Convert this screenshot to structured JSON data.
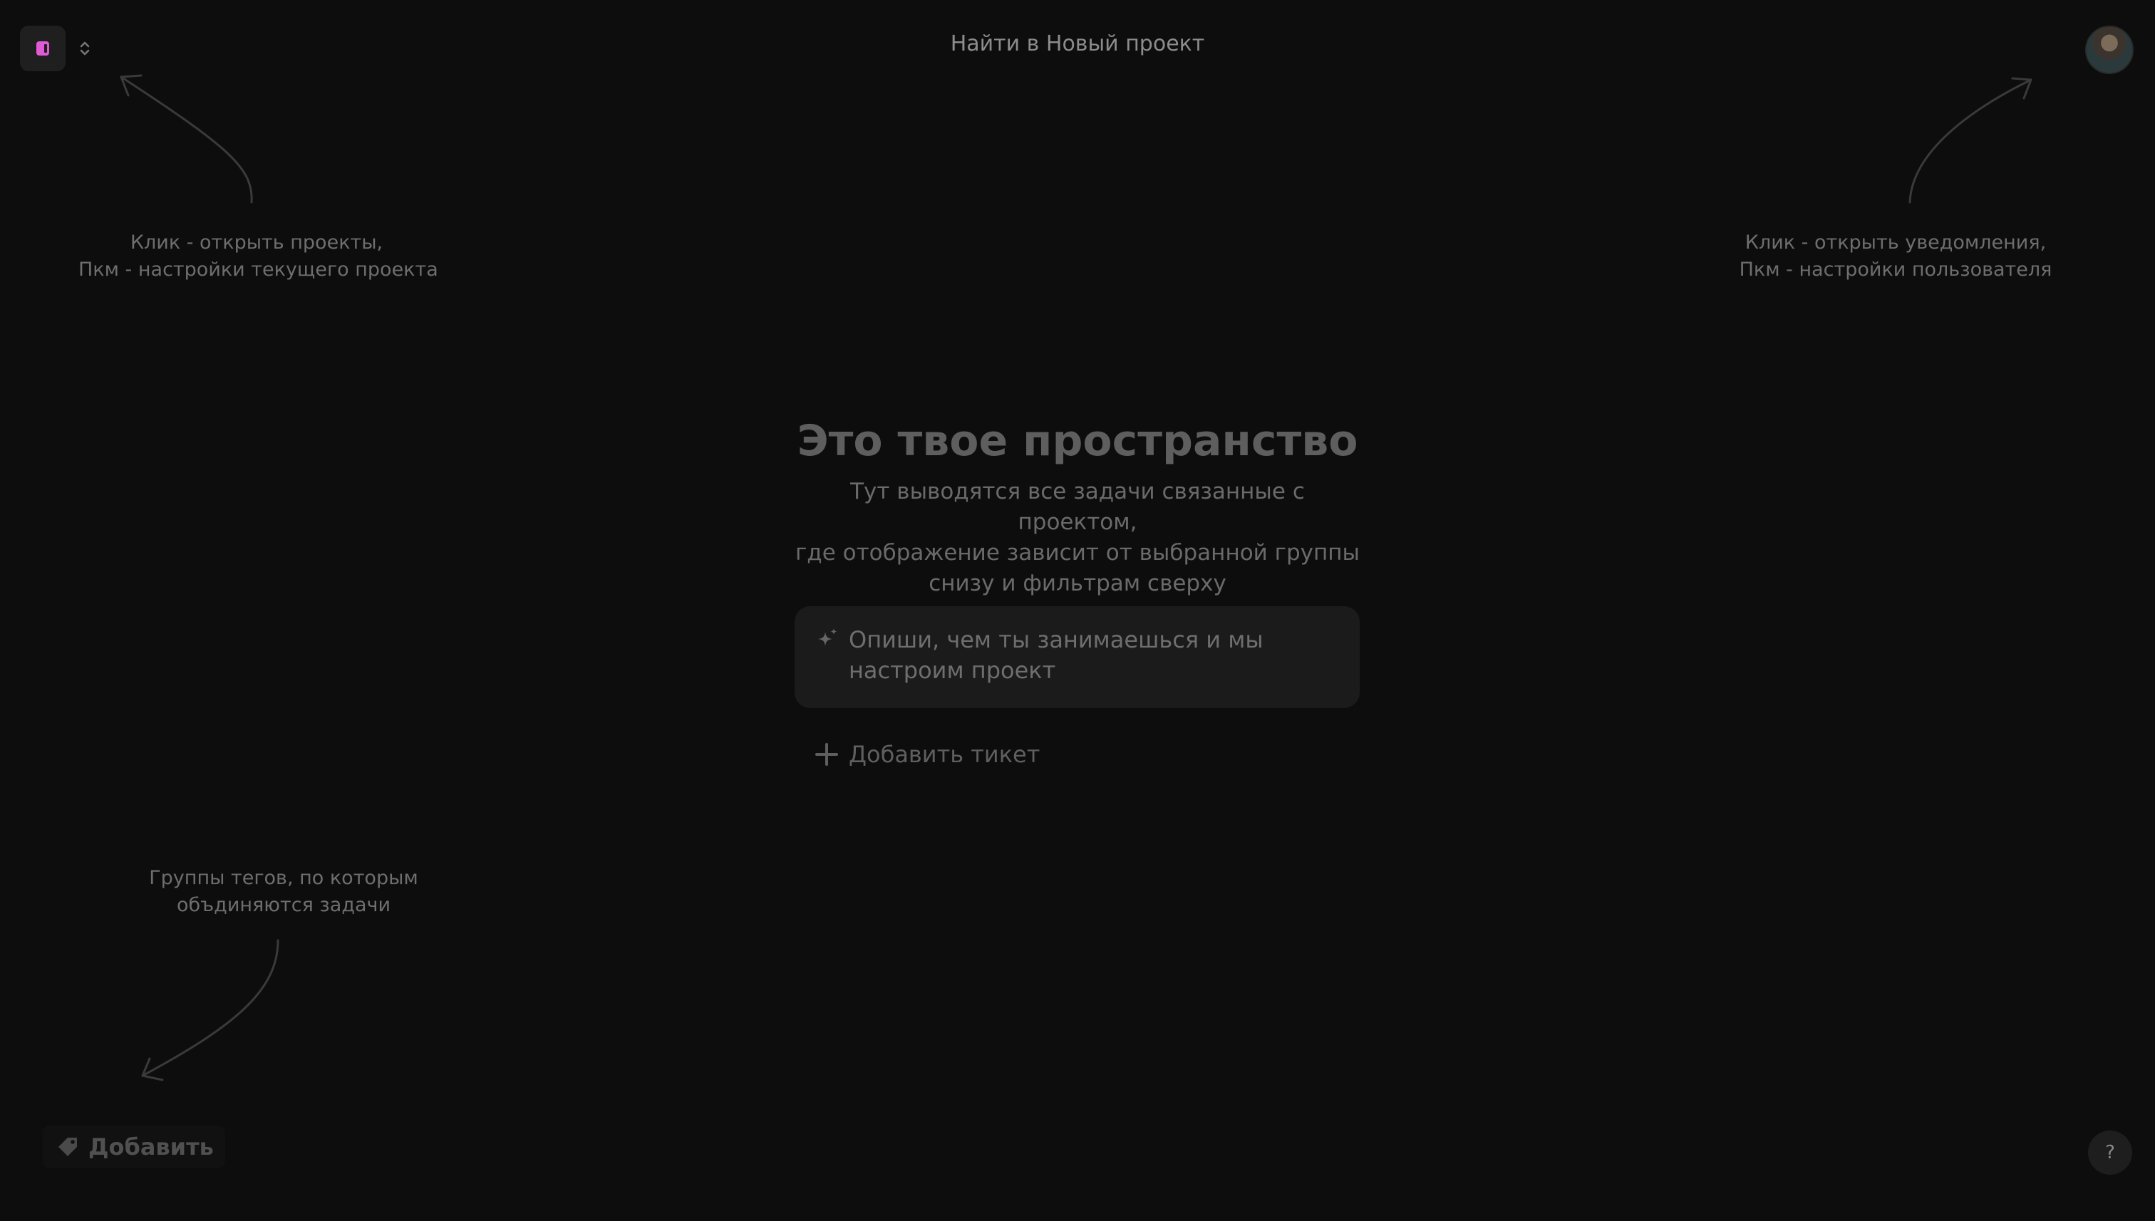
{
  "header": {
    "search_title": "Найти в Новый проект",
    "project_icon": "project-logo-icon",
    "switcher_icon": "chevron-up-down-icon",
    "avatar_icon": "user-avatar",
    "accent_color": "#e05ad6"
  },
  "hints": {
    "projects_line1": "Клик - открыть проекты,",
    "projects_line2": "Пкм - настройки текущего проекта",
    "user_line1": "Клик - открыть уведомления,",
    "user_line2": "Пкм - настройки пользователя",
    "groups_line1": "Группы тегов, по которым",
    "groups_line2": "объдиняются задачи"
  },
  "empty_state": {
    "title": "Это твое пространство",
    "description_line1": "Тут выводятся все задачи связанные с проектом,",
    "description_line2": "где отображение зависит от выбранной группы",
    "description_line3": "снизу и фильтрам сверху"
  },
  "ai_prompt": {
    "icon": "sparkle-icon",
    "placeholder_line1": "Опиши, чем ты занимаешься и мы",
    "placeholder_line2": "настроим проект"
  },
  "add_ticket": {
    "icon": "plus-icon",
    "label": "Добавить тикет"
  },
  "bottom": {
    "add_group_icon": "tag-icon",
    "add_group_label": "Добавить",
    "help_label": "?"
  }
}
